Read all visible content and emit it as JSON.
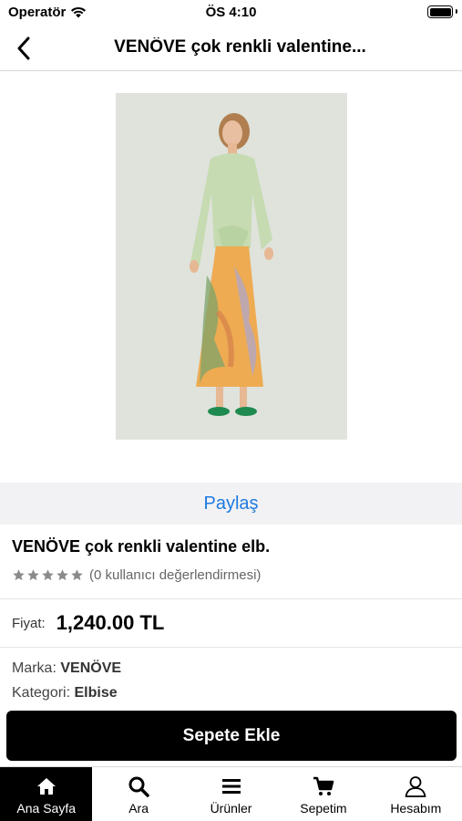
{
  "status_bar": {
    "carrier": "Operatör",
    "time": "ÖS 4:10"
  },
  "nav": {
    "title": "VENÖVE çok renkli valentine..."
  },
  "product": {
    "share_label": "Paylaş",
    "name": "VENÖVE çok renkli valentine elb.",
    "rating_text": "(0 kullanıcı değerlendirmesi)",
    "rating": 0,
    "price_label": "Fiyat:",
    "price": "1,240.00 TL",
    "brand_label": "Marka:",
    "brand": "VENÖVE",
    "category_label": "Kategori:",
    "category": "Elbise"
  },
  "add_to_cart": "Sepete Ekle",
  "tabs": [
    {
      "label": "Ana Sayfa",
      "icon": "home-icon",
      "active": true
    },
    {
      "label": "Ara",
      "icon": "search-icon",
      "active": false
    },
    {
      "label": "Ürünler",
      "icon": "menu-icon",
      "active": false
    },
    {
      "label": "Sepetim",
      "icon": "cart-icon",
      "active": false
    },
    {
      "label": "Hesabım",
      "icon": "user-icon",
      "active": false
    }
  ]
}
